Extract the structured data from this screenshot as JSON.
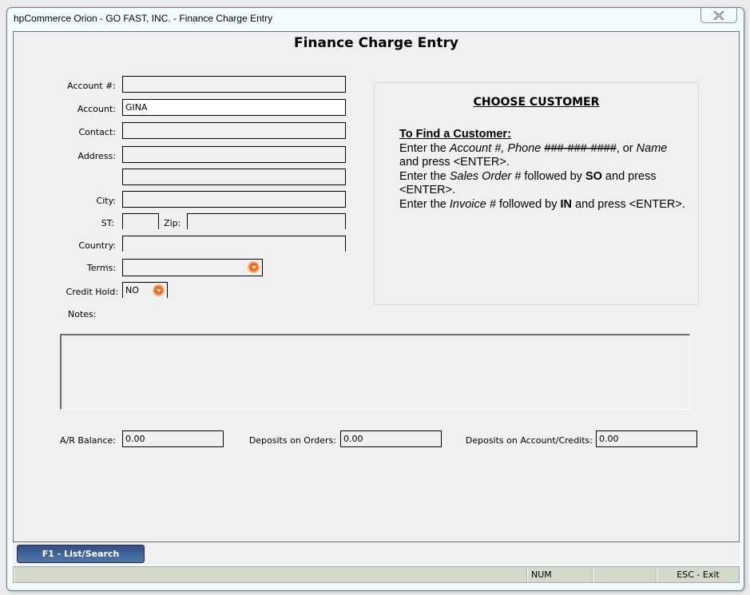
{
  "window": {
    "title": "hpCommerce Orion - GO FAST, INC. - Finance Charge Entry",
    "close_icon": "close-x-icon"
  },
  "page": {
    "title": "Finance Charge Entry"
  },
  "form": {
    "account_number": {
      "label": "Account #:",
      "value": ""
    },
    "account": {
      "label": "Account:",
      "value": "GINA"
    },
    "contact": {
      "label": "Contact:",
      "value": ""
    },
    "address": {
      "label": "Address:",
      "line1": "",
      "line2": ""
    },
    "city": {
      "label": "City:",
      "value": ""
    },
    "state": {
      "label": "ST:",
      "value": ""
    },
    "zip": {
      "label": "Zip:",
      "value": ""
    },
    "country": {
      "label": "Country:",
      "value": ""
    },
    "terms": {
      "label": "Terms:",
      "value": "",
      "icon": "dropdown-arrow-icon"
    },
    "credit_hold": {
      "label": "Credit Hold:",
      "value": "NO",
      "icon": "dropdown-arrow-icon"
    },
    "notes": {
      "label": "Notes:",
      "value": ""
    }
  },
  "help_panel": {
    "title": "CHOOSE CUSTOMER",
    "subtitle": "To Find a Customer:",
    "line1": {
      "a": "Enter the ",
      "b": "Account #, Phone ",
      "c": "###-###-####",
      "d": ", or ",
      "e": "Name",
      "f": " and press <ENTER>."
    },
    "line2": {
      "a": "Enter the ",
      "b": "Sales Order #",
      "c": " followed by ",
      "d": "SO",
      "e": " and press <ENTER>."
    },
    "line3": {
      "a": "Enter the ",
      "b": "Invoice #",
      "c": " followed by ",
      "d": "IN",
      "e": " and press <ENTER>."
    }
  },
  "summary": {
    "ar_balance": {
      "label": "A/R Balance:",
      "value": "0.00"
    },
    "deposits_on_orders": {
      "label": "Deposits on Orders:",
      "value": "0.00"
    },
    "deposits_on_account": {
      "label": "Deposits on Account/Credits:",
      "value": "0.00"
    }
  },
  "toolbar": {
    "f1_label": "F1 - List/Search"
  },
  "statusbar": {
    "cell1": "",
    "num": "NUM",
    "cell3": "",
    "esc": "ESC - Exit"
  }
}
